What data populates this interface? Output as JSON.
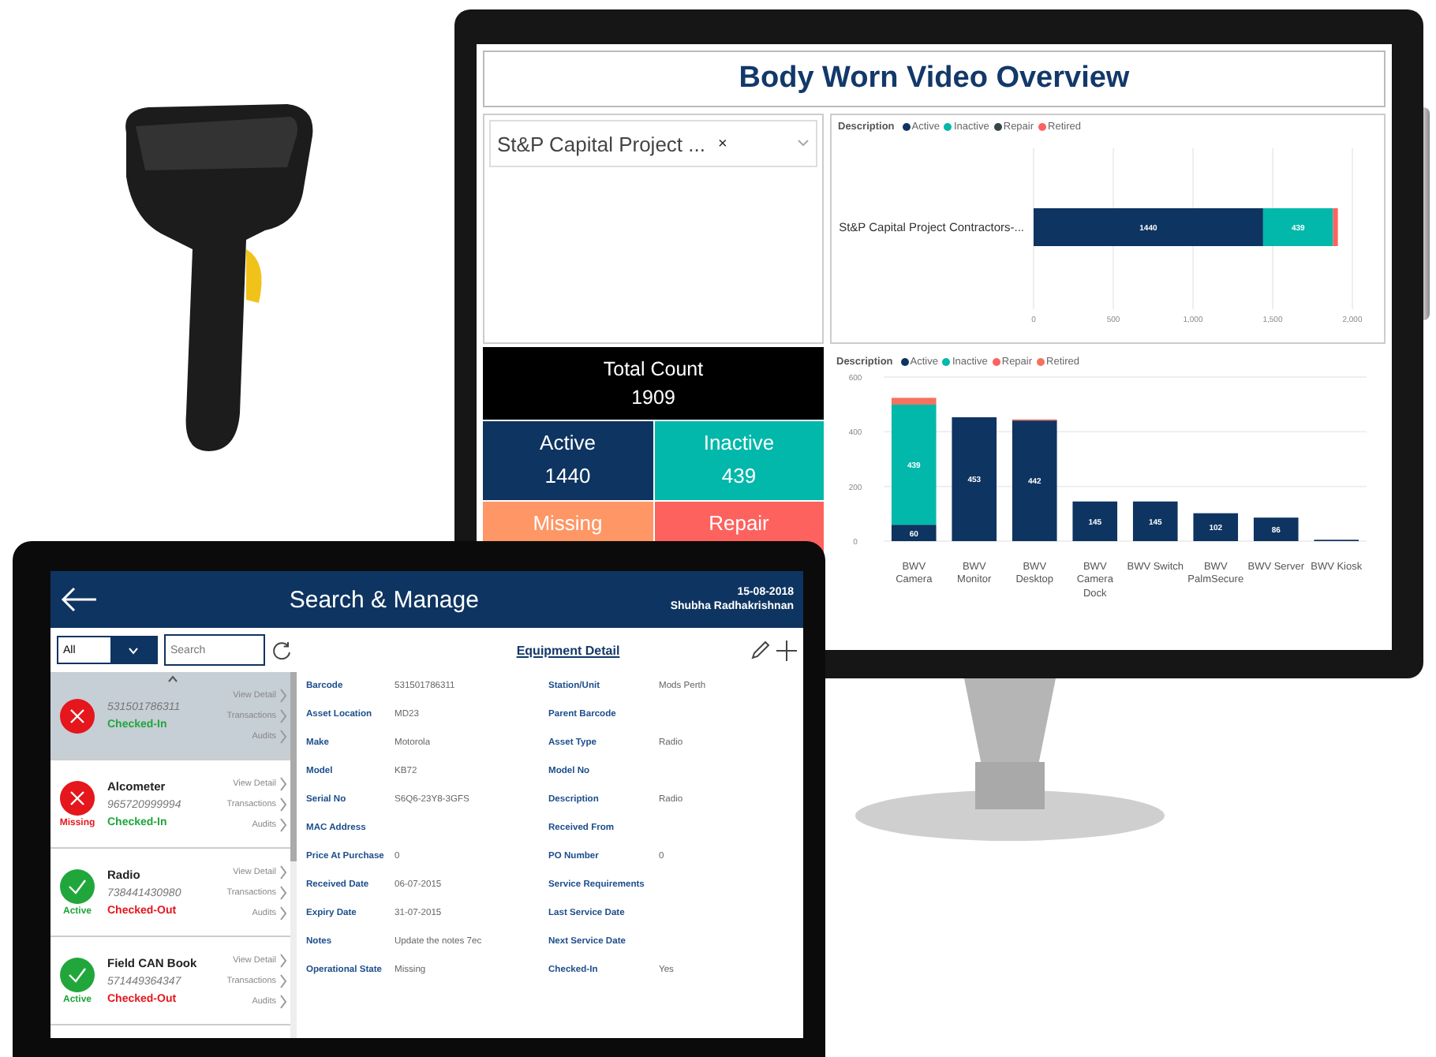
{
  "dashboard": {
    "title": "Body Worn Video Overview",
    "slicer": {
      "value": "St&P Capital Project ...",
      "clear": "×"
    },
    "total": {
      "label": "Total Count",
      "value": "1909"
    },
    "tiles": [
      {
        "label": "Active",
        "value": "1440",
        "color": "#0e3461"
      },
      {
        "label": "Inactive",
        "value": "439",
        "color": "#01b8aa"
      },
      {
        "label": "Missing",
        "color": "#fe9666"
      },
      {
        "label": "Repair",
        "color": "#fd625e"
      }
    ],
    "chart_top": {
      "legend_title": "Description",
      "chart_data": {
        "type": "bar",
        "orientation": "horizontal",
        "stacked": true,
        "grid": true,
        "legend": "top",
        "value_labels": [
          [
            "1440"
          ],
          [
            "439"
          ],
          [
            null
          ],
          [
            null
          ]
        ],
        "categories": [
          "St&P Capital Project Contractors-..."
        ],
        "series": [
          {
            "name": "Active",
            "color": "#0e3461",
            "values": [
              1440
            ]
          },
          {
            "name": "Inactive",
            "color": "#01b8aa",
            "values": [
              439
            ]
          },
          {
            "name": "Repair",
            "color": "#374649",
            "values": [
              0
            ]
          },
          {
            "name": "Retired",
            "color": "#fd625e",
            "values": [
              30
            ]
          }
        ],
        "xlim": [
          0,
          2000
        ],
        "xticks": [
          {
            "value": 0,
            "label": "0"
          },
          {
            "value": 500,
            "label": "500"
          },
          {
            "value": 1000,
            "label": "1,000"
          },
          {
            "value": 1500,
            "label": "1,500"
          },
          {
            "value": 2000,
            "label": "2,000"
          }
        ]
      }
    },
    "chart_bottom": {
      "legend_title": "Description",
      "chart_data": {
        "type": "bar",
        "orientation": "vertical",
        "stacked": true,
        "grid": true,
        "legend": "top",
        "value_labels": [
          [
            "60",
            "453",
            "442",
            "145",
            "145",
            "102",
            "86",
            null
          ],
          [
            "439",
            null,
            null,
            null,
            null,
            null,
            null,
            null
          ],
          [
            null,
            null,
            null,
            null,
            null,
            null,
            null,
            null
          ],
          [
            null,
            null,
            null,
            null,
            null,
            null,
            null,
            null
          ]
        ],
        "categories": [
          "BWV Camera",
          "BWV Monitor",
          "BWV Desktop",
          "BWV Camera Dock",
          "BWV Switch",
          "BWV PalmSecure",
          "BWV Server",
          "BWV Kiosk"
        ],
        "series": [
          {
            "name": "Active",
            "color": "#0e3461",
            "values": [
              60,
              453,
              442,
              145,
              145,
              102,
              86,
              5
            ]
          },
          {
            "name": "Inactive",
            "color": "#01b8aa",
            "values": [
              439,
              0,
              0,
              0,
              0,
              0,
              0,
              0
            ]
          },
          {
            "name": "Repair",
            "color": "#fd625e",
            "values": [
              0,
              0,
              0,
              0,
              0,
              0,
              0,
              0
            ]
          },
          {
            "name": "Retired",
            "color": "#f4725f",
            "values": [
              25,
              0,
              3,
              0,
              0,
              0,
              0,
              0
            ]
          }
        ],
        "ylim": [
          0,
          600
        ],
        "yticks": [
          0,
          200,
          400,
          600
        ]
      }
    }
  },
  "tablet": {
    "header": {
      "title": "Search & Manage",
      "date": "15-08-2018",
      "user": "Shubha Radhakrishnan"
    },
    "filter": {
      "value": "All"
    },
    "search": {
      "placeholder": "Search"
    },
    "detail_title": "Equipment Detail",
    "items": [
      {
        "kind": "cross",
        "selected": true,
        "barcode": "531501786311",
        "check_status": "Checked-In",
        "checked_in": true,
        "links": [
          "View Detail",
          "Transactions",
          "Audits"
        ]
      },
      {
        "kind": "cross",
        "selected": false,
        "name": "Alcometer",
        "barcode": "965720999994",
        "check_status": "Checked-In",
        "checked_in": true,
        "state_label": "Missing",
        "links": [
          "View Detail",
          "Transactions",
          "Audits"
        ]
      },
      {
        "kind": "tick",
        "selected": false,
        "name": "Radio",
        "barcode": "738441430980",
        "check_status": "Checked-Out",
        "checked_in": false,
        "state_label": "Active",
        "links": [
          "View Detail",
          "Transactions",
          "Audits"
        ]
      },
      {
        "kind": "tick",
        "selected": false,
        "name": "Field CAN Book",
        "barcode": "571449364347",
        "check_status": "Checked-Out",
        "checked_in": false,
        "state_label": "Active",
        "links": [
          "View Detail",
          "Transactions",
          "Audits"
        ]
      }
    ],
    "details": {
      "left": [
        {
          "label": "Barcode",
          "value": "531501786311"
        },
        {
          "label": "Asset Location",
          "value": "MD23"
        },
        {
          "label": "Make",
          "value": "Motorola"
        },
        {
          "label": "Model",
          "value": "KB72"
        },
        {
          "label": "Serial No",
          "value": "S6Q6-23Y8-3GFS"
        },
        {
          "label": "MAC Address"
        },
        {
          "label": "Price At Purchase",
          "value": "0"
        },
        {
          "label": "Received Date",
          "value": "06-07-2015"
        },
        {
          "label": "Expiry Date",
          "value": "31-07-2015"
        },
        {
          "label": "Notes",
          "value": "Update the notes 7ec"
        },
        {
          "label": "Operational State",
          "value": "Missing"
        }
      ],
      "right": [
        {
          "label": "Station/Unit",
          "value": "Mods Perth"
        },
        {
          "label": "Parent Barcode"
        },
        {
          "label": "Asset Type",
          "value": "Radio"
        },
        {
          "label": "Model No"
        },
        {
          "label": "Description",
          "value": "Radio"
        },
        {
          "label": "Received From"
        },
        {
          "label": "PO Number",
          "value": "0"
        },
        {
          "label": "Service Requirements"
        },
        {
          "label": "Last Service Date"
        },
        {
          "label": "Next Service Date"
        },
        {
          "label": "Checked-In",
          "value": "Yes"
        }
      ]
    }
  }
}
